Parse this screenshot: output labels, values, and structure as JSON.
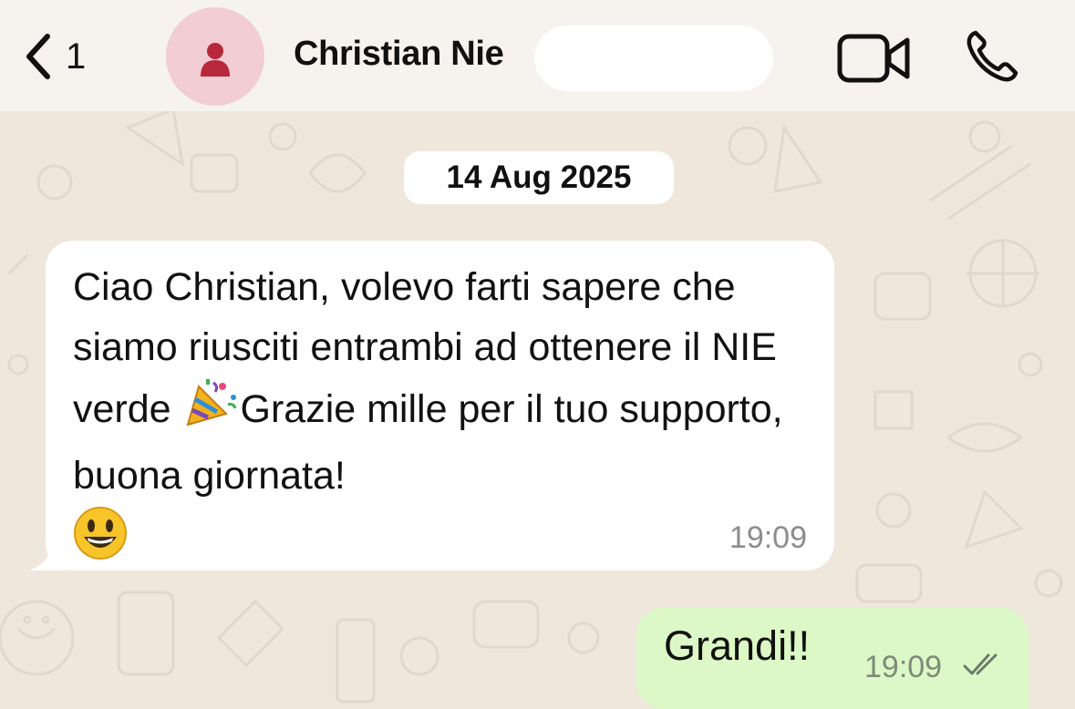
{
  "header": {
    "back_count": "1",
    "contact_name": "Christian Nie",
    "avatar_icon": "person-icon",
    "video_icon": "video-camera-icon",
    "call_icon": "phone-icon"
  },
  "chat": {
    "date_separator": "14 Aug 2025",
    "messages": [
      {
        "direction": "incoming",
        "text_parts": [
          "Ciao Christian, volevo farti sapere che siamo riusciti entrambi ad ottenere il NIE verde ",
          "Grazie mille per il tuo supporto, buona giornata!"
        ],
        "emojis": [
          "party-popper-icon",
          "smiling-face-icon"
        ],
        "time": "19:09"
      },
      {
        "direction": "outgoing",
        "text": "Grandi!!",
        "time": "19:09",
        "status": "read-double-check"
      }
    ]
  },
  "colors": {
    "wallpaper": "#efe7dc",
    "incoming_bubble": "#ffffff",
    "outgoing_bubble": "#dcf8c6",
    "avatar_bg": "#f2cdd3",
    "avatar_icon": "#b8283d"
  }
}
